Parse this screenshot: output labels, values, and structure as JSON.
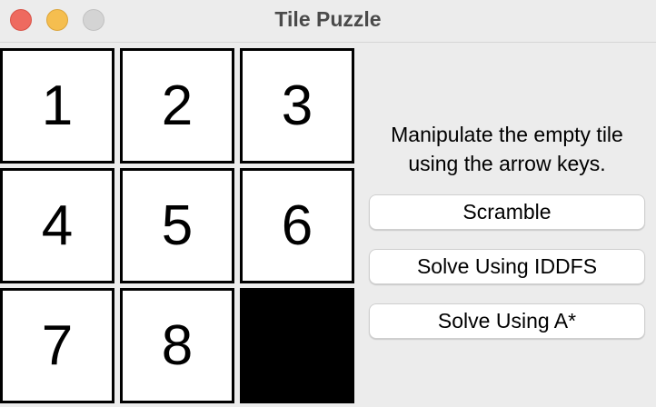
{
  "window": {
    "title": "Tile Puzzle"
  },
  "board": {
    "tiles": [
      "1",
      "2",
      "3",
      "4",
      "5",
      "6",
      "7",
      "8",
      ""
    ]
  },
  "panel": {
    "instructions_line1": "Manipulate the empty tile",
    "instructions_line2": "using the arrow keys.",
    "scramble_label": "Scramble",
    "solve_iddfs_label": "Solve Using IDDFS",
    "solve_astar_label": "Solve Using A*"
  },
  "colors": {
    "close": "#ee6a5f",
    "minimize": "#f5be4f",
    "zoom": "#d4d4d4",
    "tile_background": "#ffffff",
    "tile_border": "#000000",
    "empty_tile": "#000000"
  }
}
